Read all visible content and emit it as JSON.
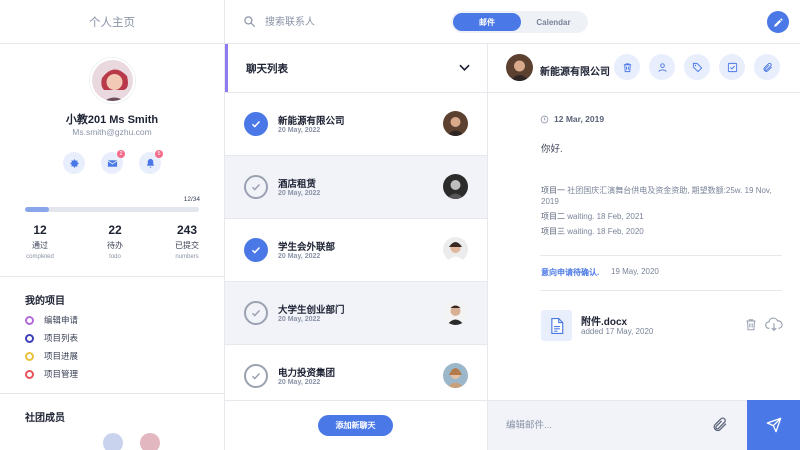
{
  "sidebar": {
    "header_title": "个人主页",
    "profile": {
      "name": "小教201 Ms Smith",
      "email": "Ms.smith@gzhu.com"
    },
    "quick_actions": [
      {
        "icon": "gear-icon"
      },
      {
        "icon": "mail-icon",
        "badge": "2"
      },
      {
        "icon": "bell-icon",
        "badge": "5"
      }
    ],
    "progress": {
      "text": "12/34",
      "fraction": 0.14
    },
    "stats": [
      {
        "value": "12",
        "label": "通过",
        "sub": "completed"
      },
      {
        "value": "22",
        "label": "待办",
        "sub": "todo"
      },
      {
        "value": "243",
        "label": "已提交",
        "sub": "numbers"
      }
    ],
    "projects": {
      "title": "我的项目",
      "items": [
        {
          "label": "编辑申请",
          "color": "#b36ad9"
        },
        {
          "label": "项目列表",
          "color": "#3e3fb8"
        },
        {
          "label": "项目进展",
          "color": "#e8c23a"
        },
        {
          "label": "项目管理",
          "color": "#e8535b"
        }
      ]
    },
    "members_title": "社团成员"
  },
  "topbar": {
    "search_placeholder": "搜索联系人",
    "tabs": [
      {
        "label": "邮件",
        "active": true
      },
      {
        "label": "Calendar",
        "active": false
      }
    ],
    "compose_icon": "pencil-icon"
  },
  "chats": {
    "header_title": "聊天列表",
    "items": [
      {
        "name": "新能源有限公司",
        "date": "20 May, 2022",
        "checked": true
      },
      {
        "name": "酒店租赁",
        "date": "20 May, 2022",
        "checked": false
      },
      {
        "name": "学生会外联部",
        "date": "20 May, 2022",
        "checked": true
      },
      {
        "name": "大学生创业部门",
        "date": "20 May, 2022",
        "checked": false
      },
      {
        "name": "电力投资集团",
        "date": "20 May, 2022",
        "checked": false
      }
    ],
    "add_button": "添加新聊天"
  },
  "message": {
    "sender": "新能源有限公司",
    "actions": [
      "trash-icon",
      "user-icon",
      "tag-icon",
      "check-square-icon",
      "paperclip-icon"
    ],
    "date": "12 Mar, 2019",
    "body": "你好.",
    "history": [
      {
        "label": "项目一",
        "text": "社团国庆汇演舞台供电及资金资助, 期望数额:25w. 19 Nov, 2019"
      },
      {
        "label": "项目二",
        "text": "waiting. 18 Feb, 2021"
      },
      {
        "label": "项目三",
        "text": "waiting. 18 Feb, 2020"
      }
    ],
    "approval_label": "意向申请待确认.",
    "approval_date": "19 May, 2020",
    "attachment": {
      "name": "附件.docx",
      "added": "added 17 May, 2020"
    },
    "compose_placeholder": "编辑邮件..."
  },
  "colors": {
    "accent": "#4a78e6",
    "accent_soft": "#e8eefb",
    "row_alt": "#f1f3f9",
    "badge": "#f36b88",
    "header_accent": "#8e7bf0"
  }
}
